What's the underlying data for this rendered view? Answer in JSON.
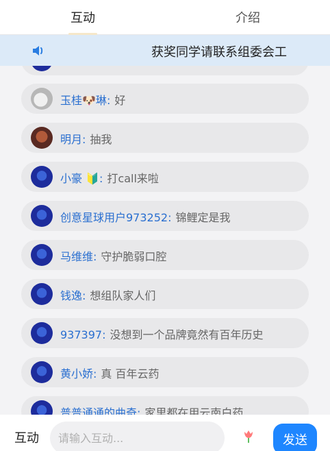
{
  "tabs": {
    "active": "互动",
    "inactive": "介绍"
  },
  "notice": {
    "text": "获奖同学请联系组委会工"
  },
  "messages": [
    {
      "name": "玉桂🐶琳",
      "text": "好",
      "avatar": "dog-photo"
    },
    {
      "name": "明月",
      "text": "抽我",
      "avatar": "person-photo"
    },
    {
      "name": "小豪 🔰",
      "text": "打call来啦",
      "avatar": "robot"
    },
    {
      "name": "创意星球用户973252",
      "text": "锦鲤定是我",
      "avatar": "robot"
    },
    {
      "name": "马维维",
      "text": "守护脆弱口腔",
      "avatar": "robot"
    },
    {
      "name": "钱逸",
      "text": "想组队家人们",
      "avatar": "robot"
    },
    {
      "name": "937397",
      "text": "没想到一个品牌竟然有百年历史",
      "avatar": "robot"
    },
    {
      "name": "黄小娇",
      "text": "真 百年云药",
      "avatar": "robot"
    },
    {
      "name": "普普通通的曲奇",
      "text": "家里都在用云南白药",
      "avatar": "robot"
    }
  ],
  "separator": ":",
  "bottom": {
    "label": "互动",
    "placeholder": "请输入互动...",
    "send_label": "发送"
  },
  "colors": {
    "accent": "#1e86ff",
    "name_blue": "#2a6fd0",
    "notice_bg": "#dceaf8"
  }
}
